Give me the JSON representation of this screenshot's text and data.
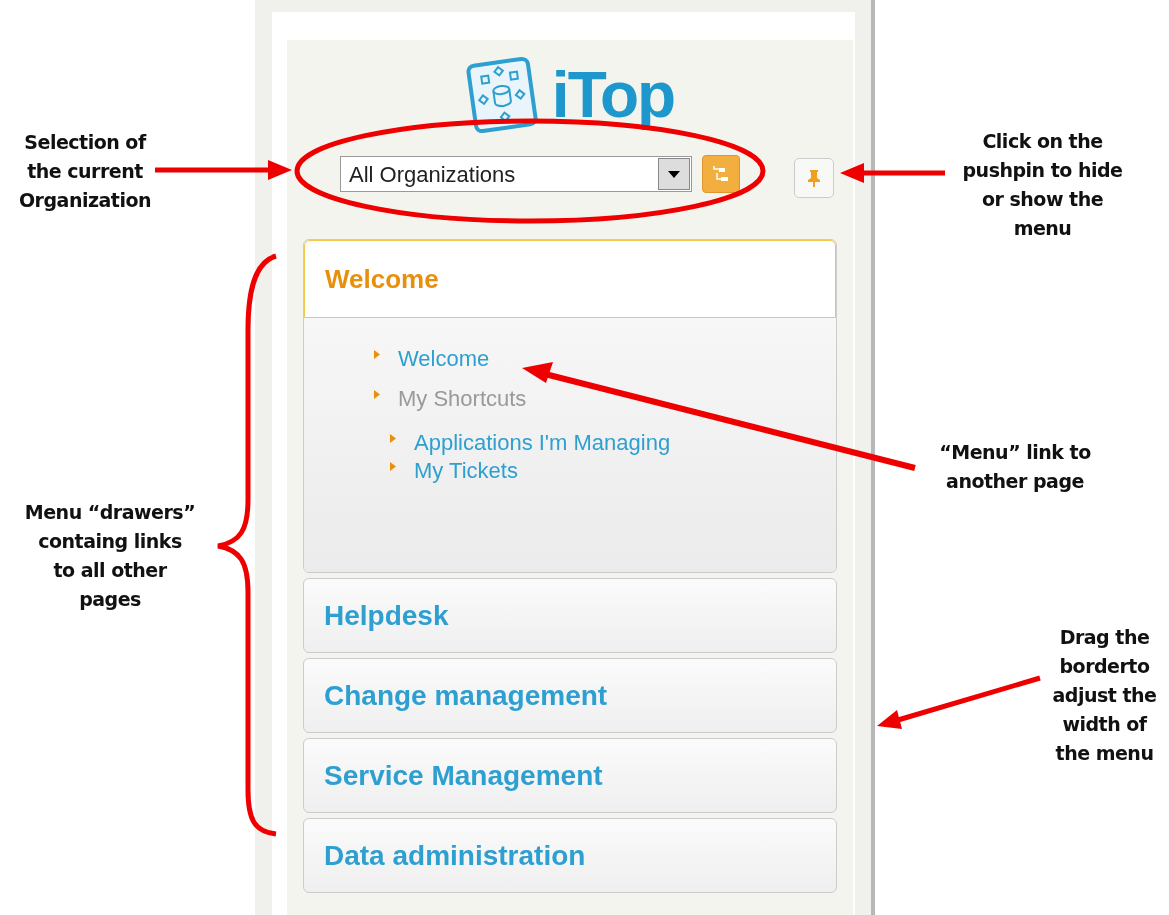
{
  "logo": {
    "text": "iTop"
  },
  "organization_select": {
    "value": "All Organizations"
  },
  "drawers": [
    {
      "title": "Welcome",
      "expanded": true,
      "items": [
        {
          "label": "Welcome",
          "kind": "link"
        },
        {
          "label": "My Shortcuts",
          "kind": "group",
          "children": [
            {
              "label": "Applications I'm Managing",
              "kind": "link"
            },
            {
              "label": "My Tickets",
              "kind": "link"
            }
          ]
        }
      ]
    },
    {
      "title": "Helpdesk",
      "expanded": false
    },
    {
      "title": "Change management",
      "expanded": false
    },
    {
      "title": "Service Management",
      "expanded": false
    },
    {
      "title": "Data administration",
      "expanded": false
    }
  ],
  "annotations": [
    {
      "kind": "org",
      "text": "Selection of\nthe current\nOrganization"
    },
    {
      "kind": "pin",
      "text": "Click on the\npushpin to hide\nor show the\nmenu"
    },
    {
      "kind": "drawers",
      "text": "Menu “drawers”\ncontaing links\nto all other\npages"
    },
    {
      "kind": "link",
      "text": "“Menu” link to\nanother page"
    },
    {
      "kind": "border",
      "text": "Drag the\nborderto\nadjust the\nwidth of\nthe menu"
    }
  ]
}
